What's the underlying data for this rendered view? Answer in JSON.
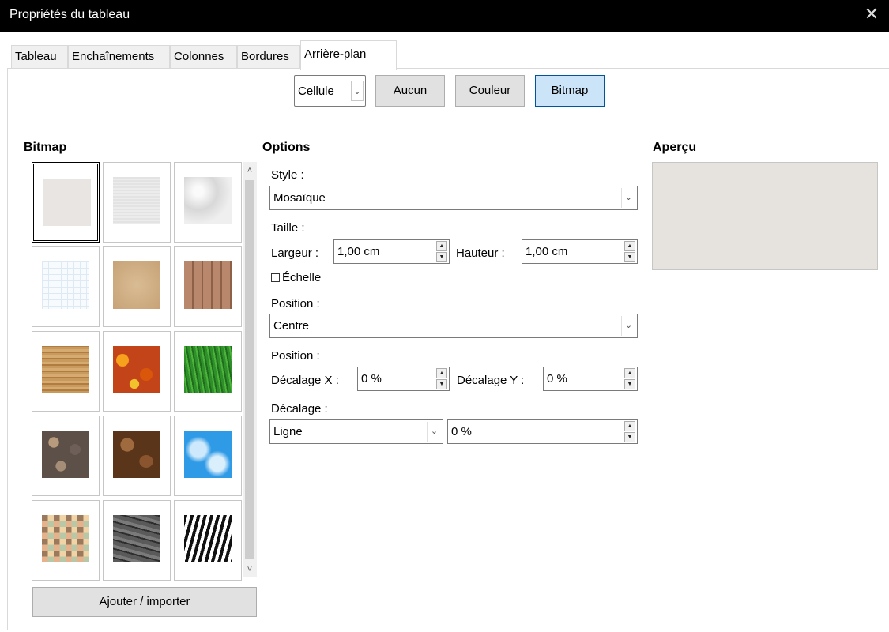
{
  "window": {
    "title": "Propriétés du tableau",
    "close_glyph": "✕"
  },
  "tabs": [
    {
      "label": "Tableau"
    },
    {
      "label": "Enchaînements"
    },
    {
      "label": "Colonnes"
    },
    {
      "label": "Bordures"
    },
    {
      "label": "Arrière-plan",
      "active": true
    }
  ],
  "topbar": {
    "target_select": "Cellule",
    "buttons": {
      "none": "Aucun",
      "color": "Couleur",
      "bitmap": "Bitmap"
    },
    "active_button": "Bitmap"
  },
  "bitmap": {
    "title": "Bitmap",
    "tiles": [
      {
        "name": "painted-white-icon",
        "selected": true
      },
      {
        "name": "paper-texture-icon"
      },
      {
        "name": "paper-crumpled-icon"
      },
      {
        "name": "paper-graph-icon"
      },
      {
        "name": "parchment-paper-icon"
      },
      {
        "name": "fence-icon"
      },
      {
        "name": "wooden-board-icon"
      },
      {
        "name": "maple-leaves-icon"
      },
      {
        "name": "lawn-icon"
      },
      {
        "name": "colorful-pebbles-icon"
      },
      {
        "name": "coffee-beans-icon"
      },
      {
        "name": "little-clouds-icon"
      },
      {
        "name": "color-mosaic-icon"
      },
      {
        "name": "stone-wall-icon"
      },
      {
        "name": "zebra-icon"
      }
    ],
    "add_button": "Ajouter / importer"
  },
  "options": {
    "title": "Options",
    "style_label": "Style :",
    "style_value": "Mosaïque",
    "size_label": "Taille :",
    "width_label": "Largeur :",
    "width_value": "1,00 cm",
    "height_label": "Hauteur :",
    "height_value": "1,00 cm",
    "scale_label": "Échelle",
    "position_label": "Position :",
    "position_value": "Centre",
    "position2_label": "Position :",
    "offset_x_label": "Décalage X :",
    "offset_x_value": "0 %",
    "offset_y_label": "Décalage Y :",
    "offset_y_value": "0 %",
    "tiling_label": "Décalage :",
    "tiling_mode": "Ligne",
    "tiling_value": "0 %"
  },
  "preview": {
    "title": "Aperçu"
  }
}
